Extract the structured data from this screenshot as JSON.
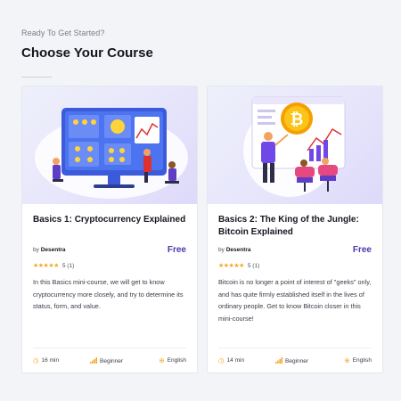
{
  "header": {
    "eyebrow": "Ready To Get Started?",
    "title": "Choose Your Course"
  },
  "colors": {
    "accent": "#4b3aa8",
    "star": "#f5a623",
    "background": "#f3f4f7"
  },
  "courses": [
    {
      "title": "Basics 1: Cryptocurrency Explained",
      "by_prefix": "by",
      "author": "Desentra",
      "price": "Free",
      "stars": "★★★★★",
      "rating_count": "5 (1)",
      "description": "In this Basics mini-course, we will get to know cryptocurrency more closely, and try to determine its status, form, and value.",
      "duration": "16 min",
      "level": "Beginner",
      "language": "English",
      "icons": {
        "duration": "clock-icon",
        "level": "signal-bars-icon",
        "language": "globe-icon"
      }
    },
    {
      "title": "Basics 2: The King of the Jungle: Bitcoin Explained",
      "by_prefix": "by",
      "author": "Desentra",
      "price": "Free",
      "stars": "★★★★★",
      "rating_count": "5 (1)",
      "description": "Bitcoin is no longer a point of interest of \"geeks\" only, and has quite firmly established itself in the lives of ordinary people. Get to know Bitcoin closer in this mini-course!",
      "duration": "14 min",
      "level": "Beginner",
      "language": "English",
      "icons": {
        "duration": "clock-icon",
        "level": "signal-bars-icon",
        "language": "globe-icon"
      }
    }
  ]
}
